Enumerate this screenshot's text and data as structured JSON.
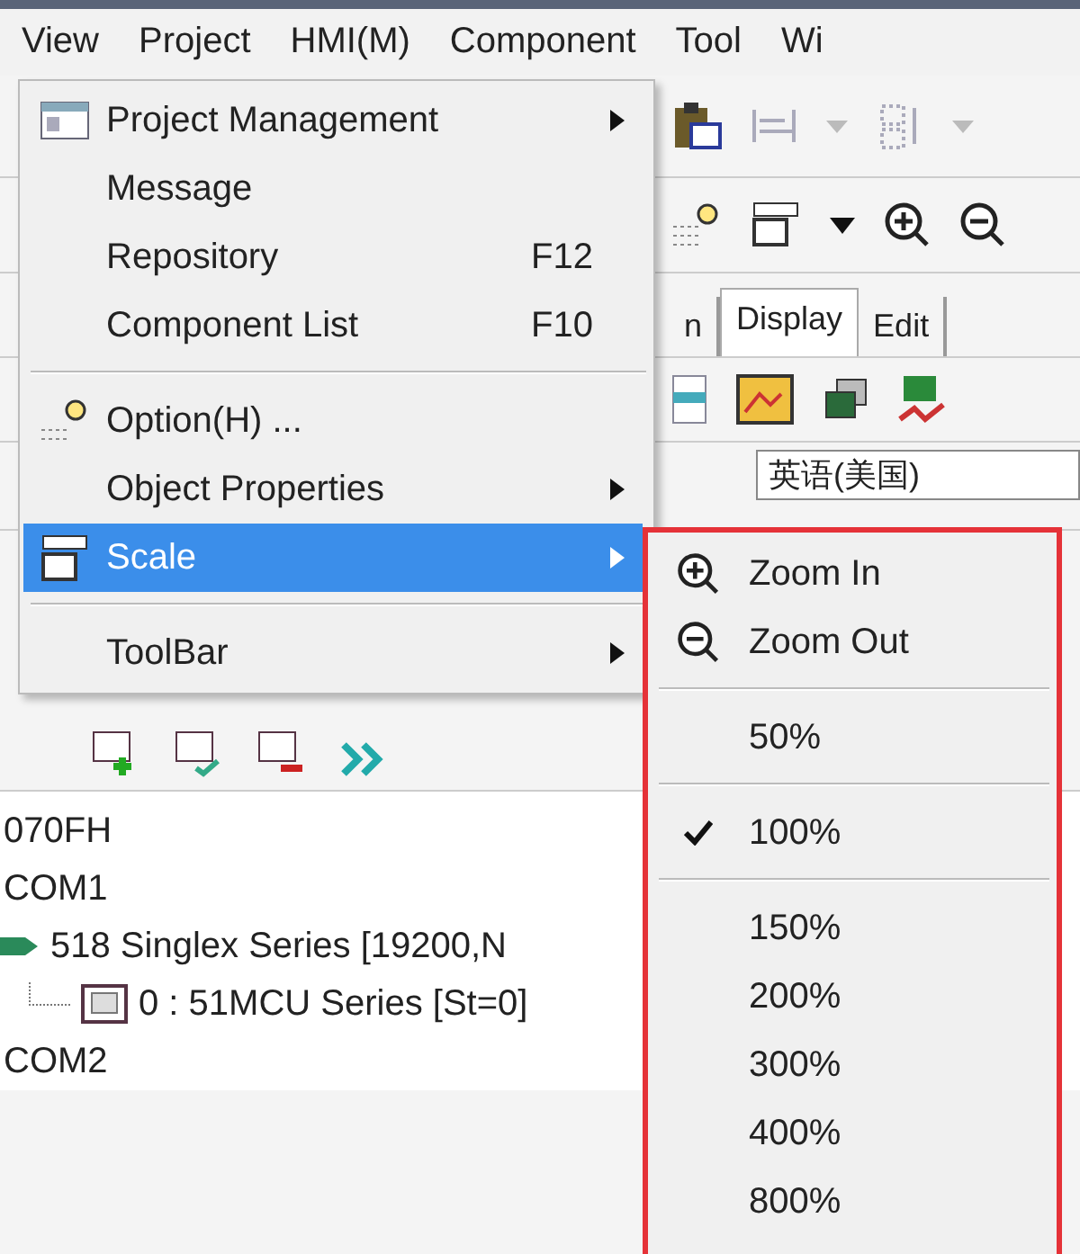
{
  "menubar": [
    {
      "label": "View"
    },
    {
      "label": "Project"
    },
    {
      "label": "HMI(M)"
    },
    {
      "label": "Component"
    },
    {
      "label": "Tool"
    },
    {
      "label": "Wi"
    }
  ],
  "view_menu": [
    {
      "kind": "item",
      "label": "Project Management",
      "submenu": true,
      "selected": false
    },
    {
      "kind": "item",
      "label": "Message",
      "selected": false
    },
    {
      "kind": "item",
      "label": "Repository",
      "shortcut": "F12",
      "selected": false
    },
    {
      "kind": "item",
      "label": "Component List",
      "shortcut": "F10",
      "selected": false
    },
    {
      "kind": "separator"
    },
    {
      "kind": "item",
      "label": "Option(H) ...",
      "selected": false
    },
    {
      "kind": "item",
      "label": "Object Properties",
      "submenu": true,
      "selected": false
    },
    {
      "kind": "item",
      "label": "Scale",
      "submenu": true,
      "selected": true
    },
    {
      "kind": "separator"
    },
    {
      "kind": "item",
      "label": "ToolBar",
      "submenu": true,
      "selected": false
    }
  ],
  "scale_menu": [
    {
      "kind": "zoomin",
      "label": "Zoom In"
    },
    {
      "kind": "zoomout",
      "label": "Zoom Out"
    },
    {
      "kind": "separator"
    },
    {
      "kind": "percent",
      "label": "50%",
      "checked": false
    },
    {
      "kind": "separator"
    },
    {
      "kind": "percent",
      "label": "100%",
      "checked": true
    },
    {
      "kind": "separator"
    },
    {
      "kind": "percent",
      "label": "150%",
      "checked": false
    },
    {
      "kind": "percent",
      "label": "200%",
      "checked": false
    },
    {
      "kind": "percent",
      "label": "300%",
      "checked": false
    },
    {
      "kind": "percent",
      "label": "400%",
      "checked": false
    },
    {
      "kind": "percent",
      "label": "800%",
      "checked": false
    }
  ],
  "tabs": [
    {
      "label": "n",
      "selected": false
    },
    {
      "label": "Display",
      "selected": true
    },
    {
      "label": "Edit",
      "selected": false
    }
  ],
  "language_field": {
    "value": "英语(美国)"
  },
  "tree": [
    {
      "label": "070FH"
    },
    {
      "label": "COM1",
      "children": [
        {
          "label": "518 Singlex Series [19200,N",
          "children": [
            {
              "label": "0 : 51MCU Series [St=0]"
            }
          ]
        }
      ]
    },
    {
      "label": "COM2"
    }
  ]
}
